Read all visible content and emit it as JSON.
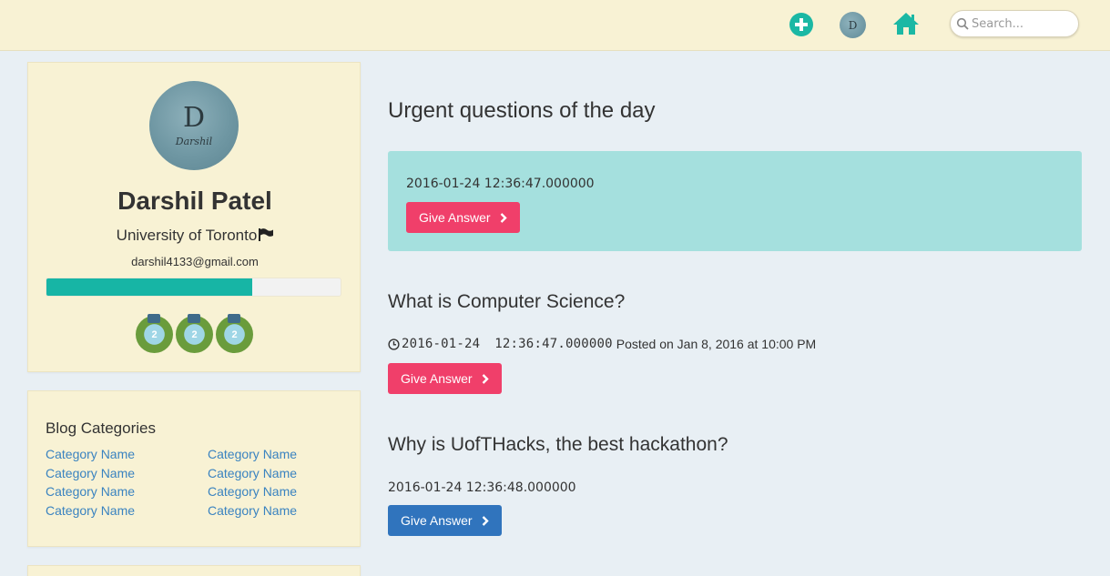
{
  "header": {
    "search_placeholder": "Search...",
    "icons": {
      "add": "plus-circle-icon",
      "avatar": "user-avatar",
      "home": "home-icon",
      "search": "search-icon"
    },
    "avatar_letter": "D"
  },
  "profile": {
    "avatar_letter": "D",
    "avatar_signature": "Darshil",
    "name": "Darshil Patel",
    "university": "University of Toronto",
    "email": "darshil4133@gmail.com",
    "progress": 0.7,
    "badges": [
      "2",
      "2",
      "2"
    ]
  },
  "blog": {
    "title": "Blog Categories",
    "categories": [
      "Category Name",
      "Category Name",
      "Category Name",
      "Category Name",
      "Category Name",
      "Category Name",
      "Category Name",
      "Category Name"
    ]
  },
  "main": {
    "title": "Urgent questions of the day",
    "urgent": {
      "timestamp": "2016-01-24 12:36:47.000000",
      "button_label": "Give Answer"
    },
    "questions": [
      {
        "title": "What is Computer Science?",
        "date": "2016-01-24",
        "time": "12:36:47.000000",
        "posted": "Posted on Jan 8, 2016 at 10:00 PM",
        "button_label": "Give Answer"
      },
      {
        "title": "Why is UofTHacks, the best hackathon?",
        "timestamp": "2016-01-24 12:36:48.000000",
        "button_label": "Give Answer"
      }
    ]
  },
  "colors": {
    "header_bg": "#f8f2d4",
    "accent_teal": "#17b5a5",
    "urgent_bg": "#a5e0de",
    "button_pink": "#f03f6a",
    "button_blue": "#3074bd",
    "link_blue": "#3a83c0"
  }
}
